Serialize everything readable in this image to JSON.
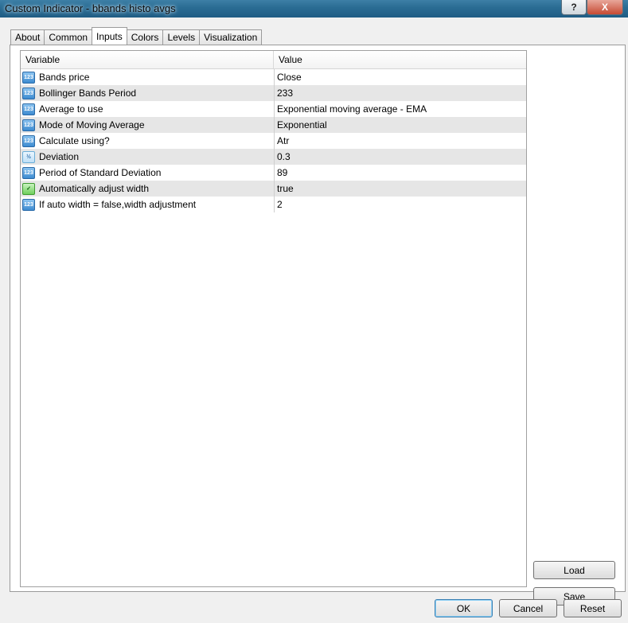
{
  "window": {
    "title": "Custom Indicator - bbands histo avgs",
    "help_label": "?",
    "close_label": "X"
  },
  "tabs": [
    {
      "label": "About"
    },
    {
      "label": "Common"
    },
    {
      "label": "Inputs"
    },
    {
      "label": "Colors"
    },
    {
      "label": "Levels"
    },
    {
      "label": "Visualization"
    }
  ],
  "grid": {
    "columns": {
      "variable": "Variable",
      "value": "Value"
    },
    "rows": [
      {
        "icon": "numeric-icon",
        "variable": "Bands price",
        "value": "Close"
      },
      {
        "icon": "numeric-icon",
        "variable": "Bollinger Bands Period",
        "value": "233"
      },
      {
        "icon": "numeric-icon",
        "variable": "Average to use",
        "value": "Exponential moving average - EMA"
      },
      {
        "icon": "numeric-icon",
        "variable": "Mode of Moving Average",
        "value": "Exponential"
      },
      {
        "icon": "numeric-icon",
        "variable": "Calculate using?",
        "value": "Atr"
      },
      {
        "icon": "fraction-icon",
        "variable": "Deviation",
        "value": "0.3"
      },
      {
        "icon": "numeric-icon",
        "variable": "Period of Standard Deviation",
        "value": "89"
      },
      {
        "icon": "boolean-icon",
        "variable": "Automatically adjust width",
        "value": "true"
      },
      {
        "icon": "numeric-icon",
        "variable": "If auto width = false,width adjustment",
        "value": "2"
      }
    ]
  },
  "icon_glyphs": {
    "numeric": "123",
    "fraction": "½",
    "boolean": "✓"
  },
  "buttons": {
    "load": "Load",
    "save": "Save",
    "ok": "OK",
    "cancel": "Cancel",
    "reset": "Reset"
  },
  "colors": {
    "titlebar": "#2b6d94",
    "alt_row": "#e6e6e6",
    "ok_border": "#3c7fb1"
  }
}
